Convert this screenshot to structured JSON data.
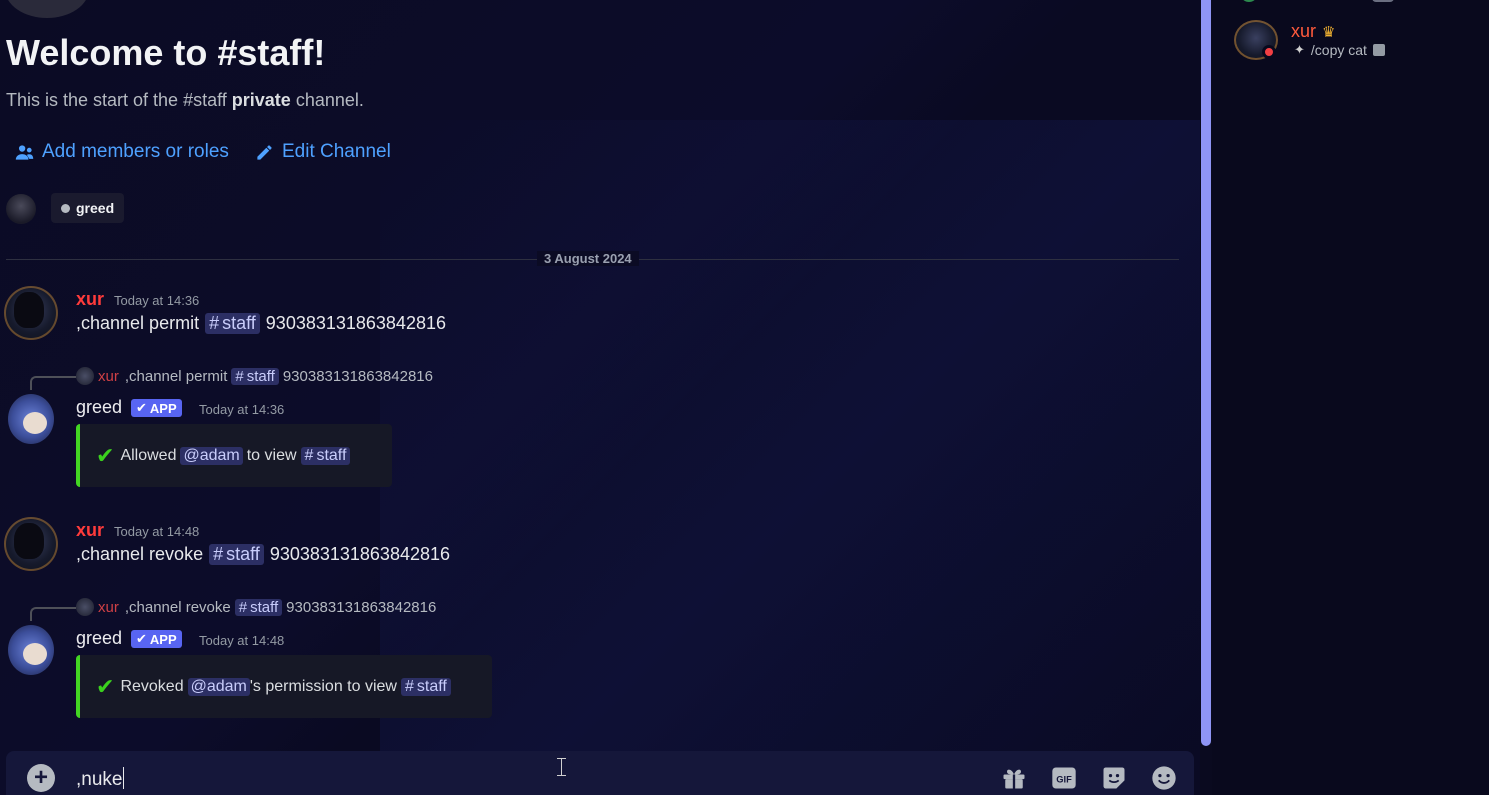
{
  "welcome": {
    "title": "Welcome to #staff!",
    "subtitle_pre": "This is the start of the #staff ",
    "subtitle_bold": "private",
    "subtitle_post": " channel."
  },
  "actions": {
    "add_members": "Add members or roles",
    "edit_channel": "Edit Channel"
  },
  "access_tag": {
    "label": "greed"
  },
  "date_divider": "3 August 2024",
  "messages": [
    {
      "author": "xur",
      "timestamp": "Today at 14:36",
      "text_pre": ",channel permit",
      "channel": "staff",
      "text_post": "930383131863842816"
    },
    {
      "reply": {
        "author": "xur",
        "text": ",channel permit",
        "channel": "staff",
        "id": "930383131863842816"
      },
      "author": "greed",
      "badge": "APP",
      "timestamp": "Today at 14:36",
      "embed": {
        "pre": "Allowed",
        "mention": "@adam",
        "mid": "to view",
        "channel": "staff"
      }
    },
    {
      "author": "xur",
      "timestamp": "Today at 14:48",
      "text_pre": ",channel revoke",
      "channel": "staff",
      "text_post": "930383131863842816"
    },
    {
      "reply": {
        "author": "xur",
        "text": ",channel revoke",
        "channel": "staff",
        "id": "930383131863842816"
      },
      "author": "greed",
      "badge": "APP",
      "timestamp": "Today at 14:48",
      "embed": {
        "pre": "Revoked",
        "mention": "@adam",
        "mid": "'s permission to view",
        "channel": "staff"
      }
    }
  ],
  "composer": {
    "value": ",nuke",
    "icons": [
      "gift-icon",
      "gif-icon",
      "sticker-icon",
      "emoji-icon"
    ]
  },
  "member_list": {
    "members": [
      {
        "name": "xur",
        "status_text": "/copy cat",
        "status": "dnd",
        "badge_icon": "crown-icon"
      }
    ]
  },
  "colors": {
    "accent": "#5865f2",
    "link": "#4ea1ff",
    "xur_name": "#ff3b3b",
    "success": "#3bd11e",
    "dnd": "#f23f43"
  }
}
